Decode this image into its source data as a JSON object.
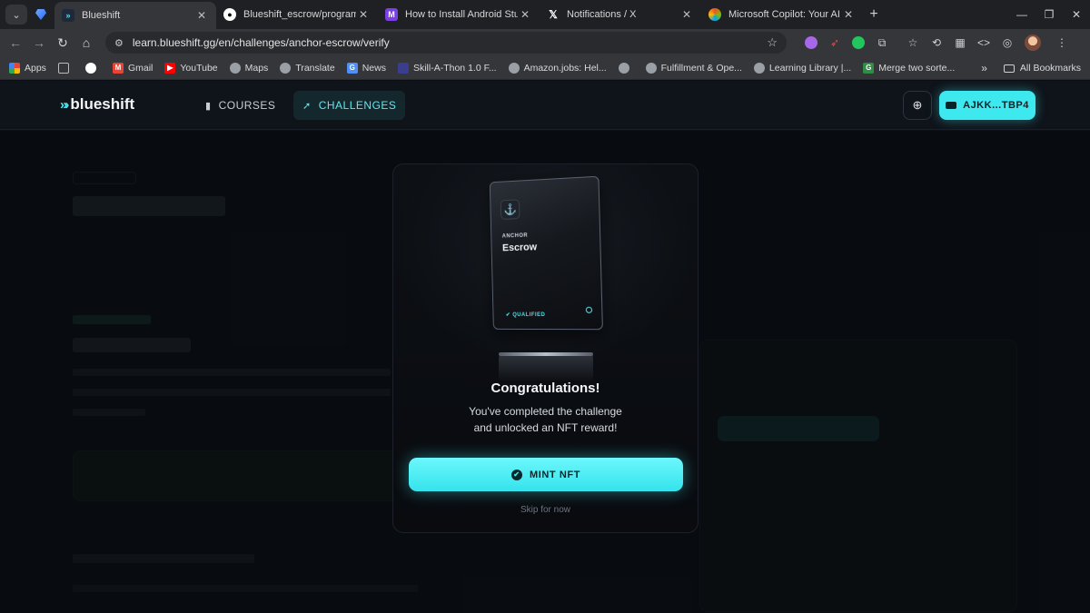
{
  "browser": {
    "tabs": [
      {
        "title": "Blueshift",
        "active": true,
        "favicon_color": "#1e2a3a"
      },
      {
        "title": "Blueshift_escrow/programs/",
        "active": false,
        "favicon_color": "#ffffff"
      },
      {
        "title": "How to Install Android Studi",
        "active": false,
        "favicon_color": "#7b3fe4"
      },
      {
        "title": "Notifications / X",
        "active": false,
        "favicon_color": "#000000"
      },
      {
        "title": "Microsoft Copilot: Your AI co",
        "active": false,
        "favicon_color": "#e35d9b"
      }
    ],
    "url": "learn.blueshift.gg/en/challenges/anchor-escrow/verify",
    "bookmarks": [
      {
        "label": "Apps",
        "color": "#e8453c"
      },
      {
        "label": "",
        "color": "#888888"
      },
      {
        "label": "",
        "color": "#ffffff"
      },
      {
        "label": "Gmail",
        "color": "#ea4335"
      },
      {
        "label": "YouTube",
        "color": "#ff0000"
      },
      {
        "label": "Maps",
        "color": "#9aa0a6"
      },
      {
        "label": "Translate",
        "color": "#9aa0a6"
      },
      {
        "label": "News",
        "color": "#4f8ff7"
      },
      {
        "label": "Skill-A-Thon 1.0 F...",
        "color": "#3b3d8f"
      },
      {
        "label": "Amazon.jobs: Hel...",
        "color": "#9aa0a6"
      },
      {
        "label": "",
        "color": "#9aa0a6"
      },
      {
        "label": "Fulfillment & Ope...",
        "color": "#9aa0a6"
      },
      {
        "label": "Learning Library |...",
        "color": "#9aa0a6"
      },
      {
        "label": "Merge two sorte...",
        "color": "#2f8d46"
      }
    ],
    "all_bookmarks": "All Bookmarks"
  },
  "site": {
    "logo": "blueshift",
    "nav": {
      "courses": "COURSES",
      "challenges": "CHALLENGES"
    },
    "wallet": "AJKK...TBP4"
  },
  "modal": {
    "card_category": "ANCHOR",
    "card_title": "Escrow",
    "card_badge": "QUALIFIED",
    "title": "Congratulations!",
    "message_line1": "You've completed the challenge",
    "message_line2": "and unlocked an NFT reward!",
    "mint_label": "MINT NFT",
    "skip_label": "Skip for now"
  },
  "colors": {
    "accent": "#3ee8ef",
    "background": "#0d1117"
  }
}
